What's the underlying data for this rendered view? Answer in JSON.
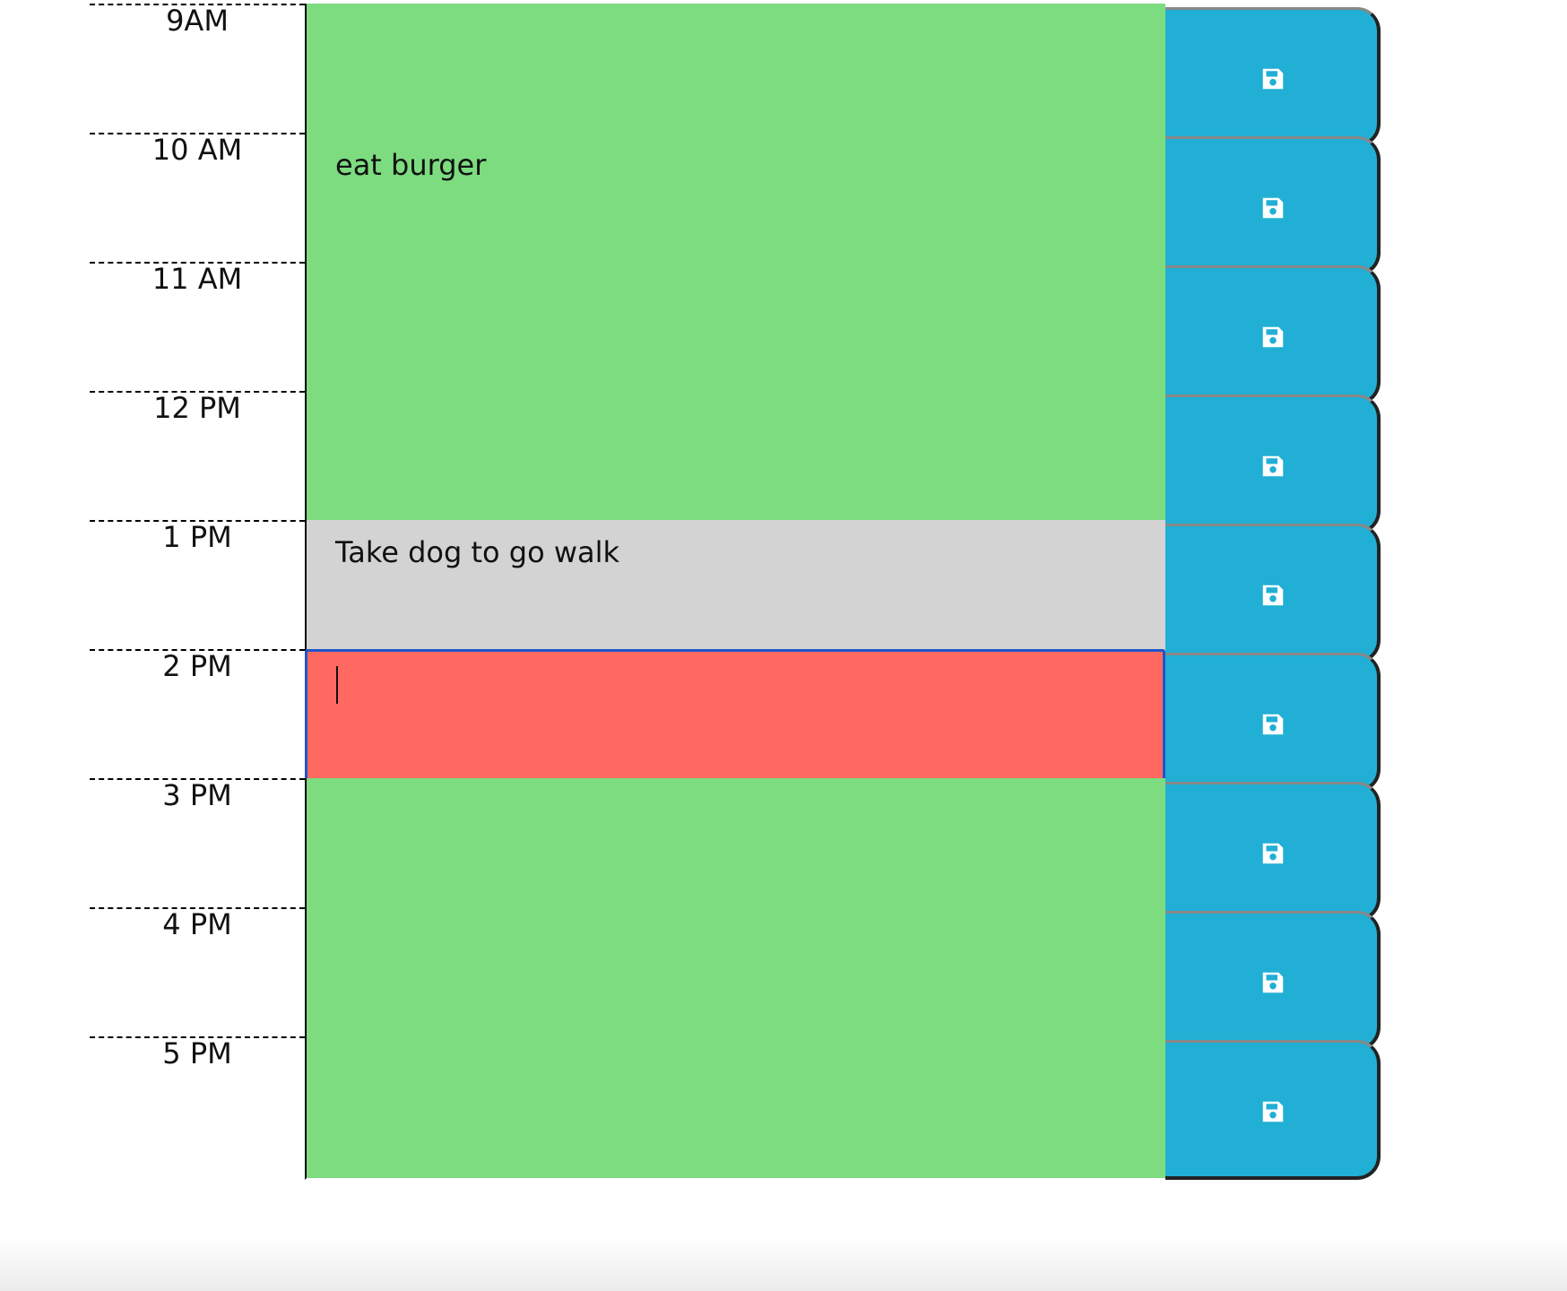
{
  "colors": {
    "past": "#d3d3d3",
    "present": "#ff6961",
    "future": "#7ddc80",
    "save_button": "#21afd5",
    "focus_border": "#1f55c9"
  },
  "save_icon": "floppy-disk-icon",
  "rows": [
    {
      "hour": "9AM",
      "text": "",
      "state": "future"
    },
    {
      "hour": "10 AM",
      "text": "eat burger",
      "state": "future"
    },
    {
      "hour": "11 AM",
      "text": "",
      "state": "future"
    },
    {
      "hour": "12 PM",
      "text": "",
      "state": "future"
    },
    {
      "hour": "1 PM",
      "text": "Take dog to go walk",
      "state": "past"
    },
    {
      "hour": "2 PM",
      "text": "",
      "state": "present",
      "focused": true
    },
    {
      "hour": "3 PM",
      "text": "",
      "state": "future"
    },
    {
      "hour": "4 PM",
      "text": "",
      "state": "future"
    },
    {
      "hour": "5 PM",
      "text": "",
      "state": "future"
    }
  ]
}
